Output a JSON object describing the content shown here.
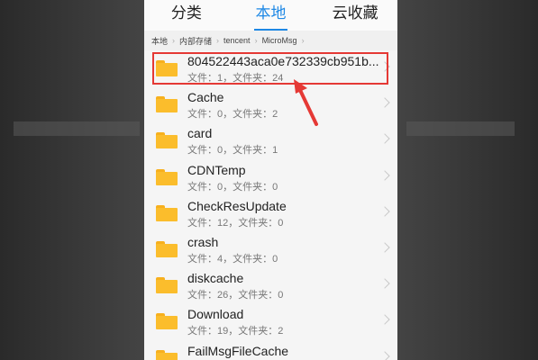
{
  "tabs": [
    {
      "label": "分类"
    },
    {
      "label": "本地"
    },
    {
      "label": "云收藏"
    }
  ],
  "breadcrumb": [
    "本地",
    "内部存储",
    "tencent",
    "MicroMsg"
  ],
  "folders": [
    {
      "name": "804522443aca0e732339cb951b...",
      "meta": "文件：1，文件夹：24",
      "highlighted": true
    },
    {
      "name": "Cache",
      "meta": "文件：0，文件夹：2"
    },
    {
      "name": "card",
      "meta": "文件：0，文件夹：1"
    },
    {
      "name": "CDNTemp",
      "meta": "文件：0，文件夹：0"
    },
    {
      "name": "CheckResUpdate",
      "meta": "文件：12，文件夹：0"
    },
    {
      "name": "crash",
      "meta": "文件：4，文件夹：0"
    },
    {
      "name": "diskcache",
      "meta": "文件：26，文件夹：0"
    },
    {
      "name": "Download",
      "meta": "文件：19，文件夹：2"
    },
    {
      "name": "FailMsgFileCache",
      "meta": ""
    }
  ],
  "colors": {
    "accent": "#1e88e5",
    "folder": "#fbbd2c",
    "highlight": "#e53935"
  }
}
